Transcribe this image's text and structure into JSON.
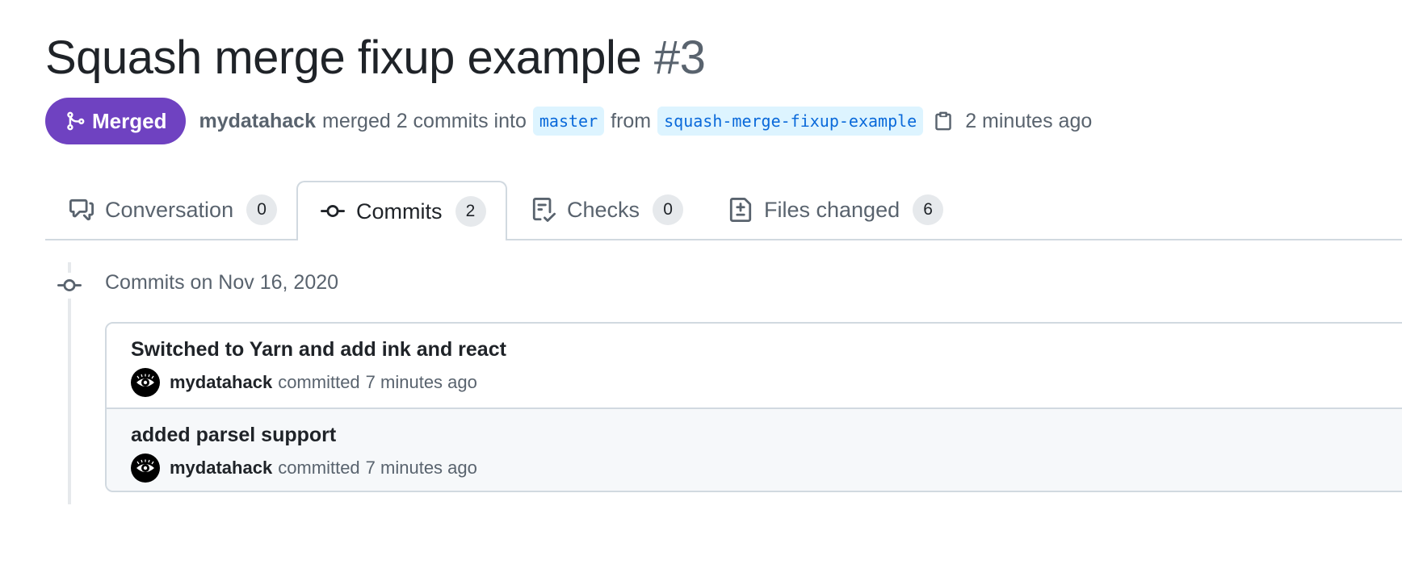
{
  "pr": {
    "title": "Squash merge fixup example",
    "number": "#3",
    "state": "Merged",
    "author": "mydatahack",
    "merge_text": "merged 2 commits into",
    "base_branch": "master",
    "from_text": "from",
    "head_branch": "squash-merge-fixup-example",
    "time": "2 minutes ago"
  },
  "tabs": [
    {
      "label": "Conversation",
      "count": "0",
      "icon": "comment-discussion-icon"
    },
    {
      "label": "Commits",
      "count": "2",
      "icon": "git-commit-icon",
      "active": true
    },
    {
      "label": "Checks",
      "count": "0",
      "icon": "checklist-icon"
    },
    {
      "label": "Files changed",
      "count": "6",
      "icon": "file-diff-icon"
    }
  ],
  "timeline": {
    "date_heading": "Commits on Nov 16, 2020",
    "commits": [
      {
        "message": "Switched to Yarn and add ink and react",
        "author": "mydatahack",
        "action": "committed",
        "time": "7 minutes ago"
      },
      {
        "message": "added parsel support",
        "author": "mydatahack",
        "action": "committed",
        "time": "7 minutes ago"
      }
    ]
  },
  "colors": {
    "merged": "#6f42c1",
    "branch_bg": "#ddf4ff",
    "branch_fg": "#0969da",
    "muted": "#59636e",
    "border": "#d1d9e0"
  }
}
